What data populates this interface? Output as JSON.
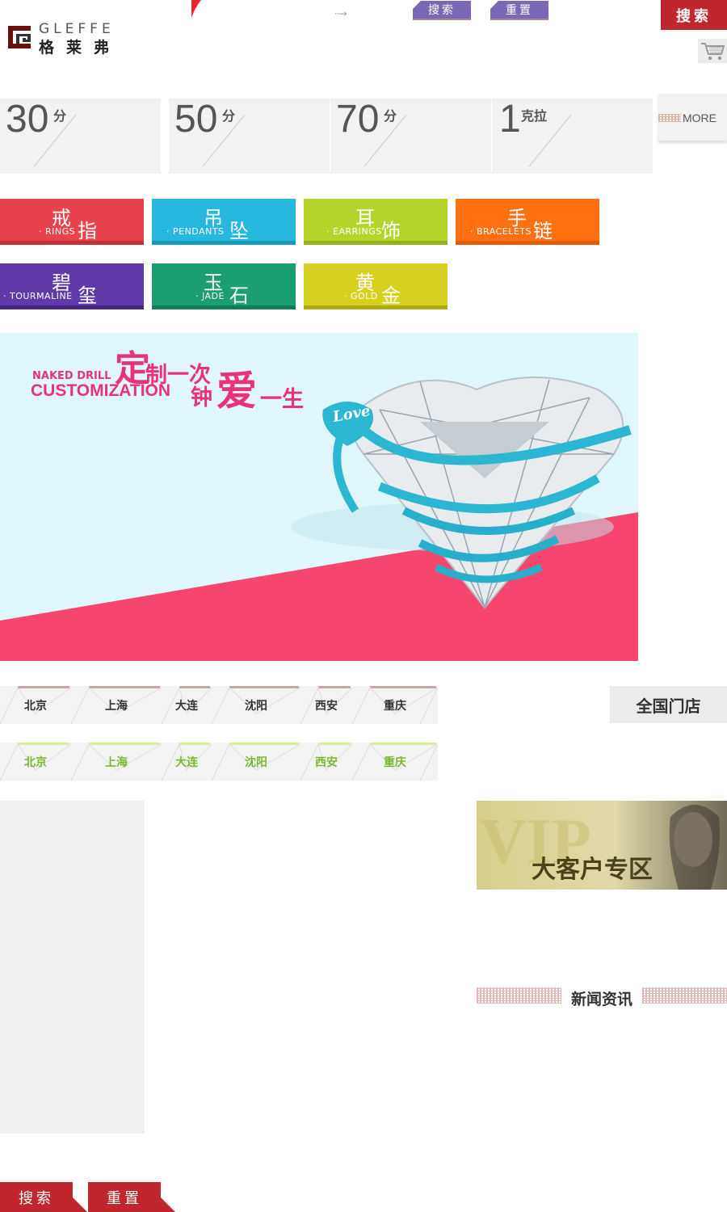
{
  "header": {
    "brand_en": "GLEFFE",
    "brand_zh": "格莱弗",
    "search_label": "搜索",
    "reset_label": "重置",
    "main_search_label": "搜索"
  },
  "carats": [
    {
      "num": "30",
      "unit": "分"
    },
    {
      "num": "50",
      "unit": "分"
    },
    {
      "num": "70",
      "unit": "分"
    },
    {
      "num": "1",
      "unit": "克拉"
    }
  ],
  "more_label": "MORE",
  "categories": [
    {
      "zh1": "戒",
      "zh2": "指",
      "en": "· RINGS",
      "color": "#e8424c",
      "bar": "#c62f37"
    },
    {
      "zh1": "吊",
      "zh2": "坠",
      "en": "· PENDANTS",
      "color": "#27b8e0",
      "bar": "#1a9ac0"
    },
    {
      "zh1": "耳",
      "zh2": "饰",
      "en": "· EARRINGS",
      "color": "#b5d52c",
      "bar": "#94b31a"
    },
    {
      "zh1": "手",
      "zh2": "链",
      "en": "· BRACELETS",
      "color": "#ff7011",
      "bar": "#e55a00"
    },
    {
      "zh1": "碧",
      "zh2": "玺",
      "en": "· TOURMALINE",
      "color": "#5f3aa8",
      "bar": "#462788"
    },
    {
      "zh1": "玉",
      "zh2": "石",
      "en": "· JADE",
      "color": "#1a9e72",
      "bar": "#0f7e58"
    },
    {
      "zh1": "黄",
      "zh2": "金",
      "en": "· GOLD",
      "color": "#d6d020",
      "bar": "#b2ab10"
    }
  ],
  "banner": {
    "en1": "NAKED DRILL",
    "en2": "CUSTOMIZATION",
    "zh_a": "定",
    "zh_b": "制一次",
    "zh_c": "钟",
    "zh_d": "爱",
    "zh_e": "一生",
    "love": "Love"
  },
  "cities_row1": [
    "北京",
    "上海",
    "大连",
    "沈阳",
    "西安",
    "重庆"
  ],
  "cities_row2": [
    "北京",
    "上海",
    "大连",
    "沈阳",
    "西安",
    "重庆"
  ],
  "nation_label": "全国门店",
  "vip": {
    "big": "VIP",
    "text": "大客户专区"
  },
  "news_title": "新闻资讯",
  "bottom": {
    "search_label": "搜索",
    "reset_label": "重置"
  }
}
